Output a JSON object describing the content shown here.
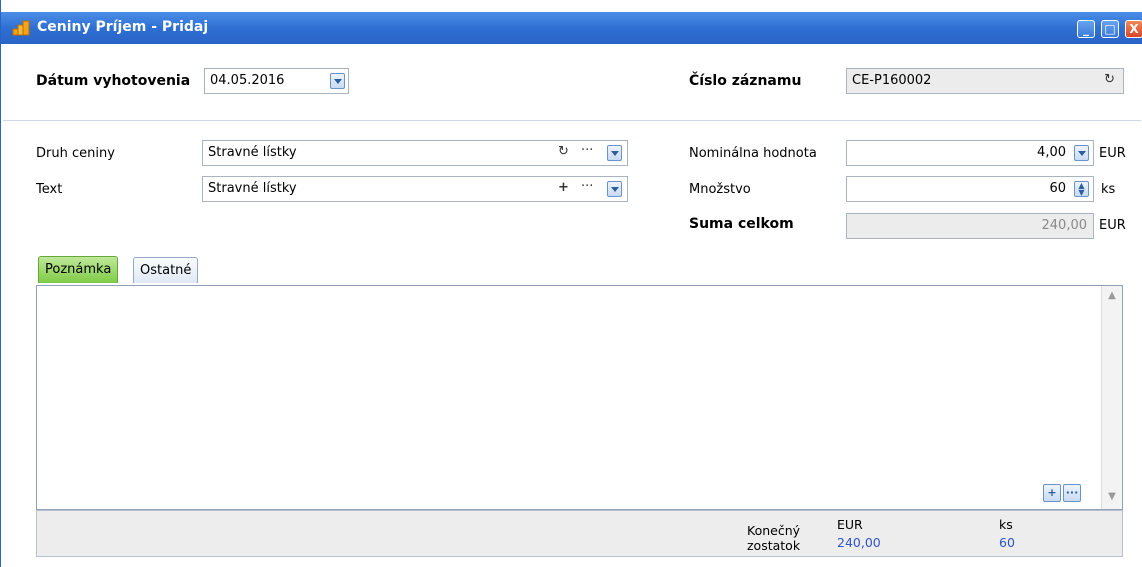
{
  "window": {
    "title": "Ceniny Príjem - Pridaj",
    "controls": {
      "minimize": "_",
      "maximize": "□",
      "close": "X"
    }
  },
  "header": {
    "date_label": "Dátum vyhotovenia",
    "date_value": "04.05.2016",
    "record_label": "Číslo záznamu",
    "record_value": "CE-P160002"
  },
  "form": {
    "type_label": "Druh ceniny",
    "type_value": "Stravné lístky",
    "text_label": "Text",
    "text_value": "Stravné lístky",
    "nominal_label": "Nominálna hodnota",
    "nominal_value": "4,00",
    "nominal_unit": "EUR",
    "qty_label": "Množstvo",
    "qty_value": "60",
    "qty_unit": "ks",
    "sum_label": "Suma celkom",
    "sum_value": "240,00",
    "sum_unit": "EUR"
  },
  "tabs": [
    {
      "label": "Poznámka",
      "active": true
    },
    {
      "label": "Ostatné",
      "active": false
    }
  ],
  "footer": {
    "balance_label_1": "Konečný",
    "balance_label_2": "zostatok",
    "eur_header": "EUR",
    "eur_value": "240,00",
    "ks_header": "ks",
    "ks_value": "60"
  },
  "colors": {
    "titlebar": "#2f6fd3",
    "active_tab": "#7fcb46",
    "value_blue": "#2f55c8"
  }
}
